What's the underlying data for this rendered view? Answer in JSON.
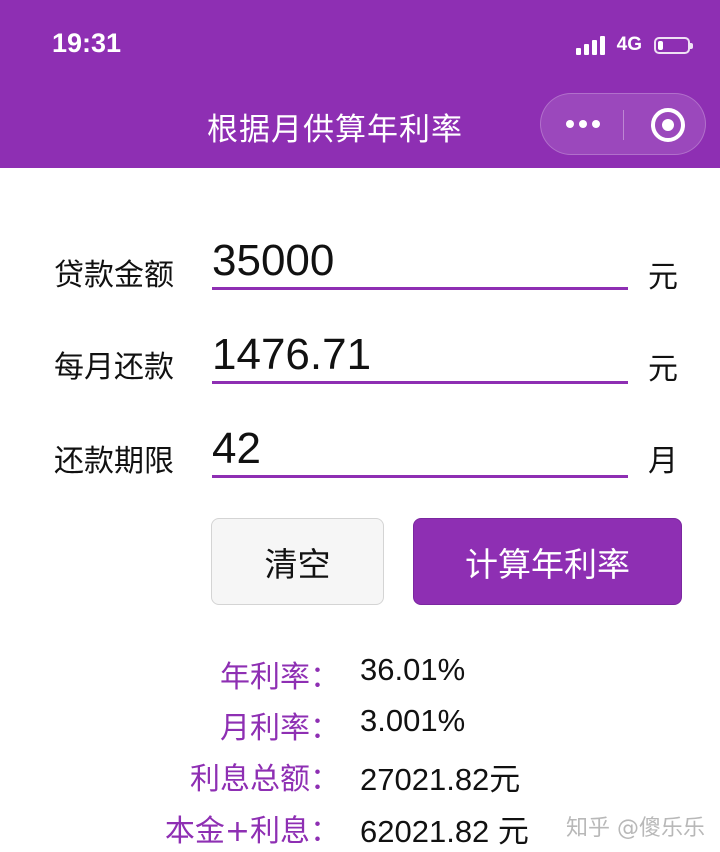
{
  "status_bar": {
    "time": "19:31",
    "network": "4G"
  },
  "nav": {
    "title": "根据月供算年利率"
  },
  "form": {
    "fields": [
      {
        "label": "贷款金额",
        "value": "35000",
        "unit": "元"
      },
      {
        "label": "每月还款",
        "value": "1476.71",
        "unit": "元"
      },
      {
        "label": "还款期限",
        "value": "42",
        "unit": "月"
      }
    ]
  },
  "buttons": {
    "clear": "清空",
    "calculate": "计算年利率"
  },
  "results": [
    {
      "label": "年利率：",
      "value": "36.01%"
    },
    {
      "label": "月利率：",
      "value": "3.001%"
    },
    {
      "label": "利息总额：",
      "value": "27021.82元"
    },
    {
      "label": "本金+利息：",
      "value": "62021.82 元"
    }
  ],
  "watermark": "知乎 @傻乐乐",
  "colors": {
    "accent": "#8e2fb3"
  }
}
